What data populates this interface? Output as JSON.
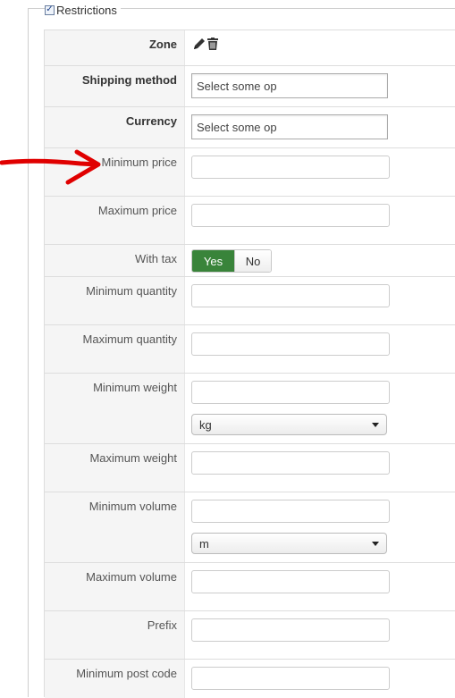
{
  "fieldset": {
    "legend": "Restrictions",
    "checked": true
  },
  "rows": {
    "zone": {
      "label": "Zone"
    },
    "shipping_method": {
      "label": "Shipping method",
      "placeholder": "Select some op"
    },
    "currency": {
      "label": "Currency",
      "placeholder": "Select some op"
    },
    "minimum_price": {
      "label": "Minimum price",
      "value": ""
    },
    "maximum_price": {
      "label": "Maximum price",
      "value": ""
    },
    "with_tax": {
      "label": "With tax",
      "yes": "Yes",
      "no": "No",
      "selected": "Yes"
    },
    "minimum_quantity": {
      "label": "Minimum quantity",
      "value": ""
    },
    "maximum_quantity": {
      "label": "Maximum quantity",
      "value": ""
    },
    "minimum_weight": {
      "label": "Minimum weight",
      "value": "",
      "unit": "kg"
    },
    "maximum_weight": {
      "label": "Maximum weight",
      "value": ""
    },
    "minimum_volume": {
      "label": "Minimum volume",
      "value": "",
      "unit": "m"
    },
    "maximum_volume": {
      "label": "Maximum volume",
      "value": ""
    },
    "prefix": {
      "label": "Prefix",
      "value": ""
    },
    "minimum_post_code": {
      "label": "Minimum post code",
      "value": ""
    }
  },
  "icons": {
    "edit": "pencil-icon",
    "delete": "trash-icon"
  },
  "colors": {
    "yes_active": "#39843a",
    "annotation_arrow": "#e00000"
  }
}
